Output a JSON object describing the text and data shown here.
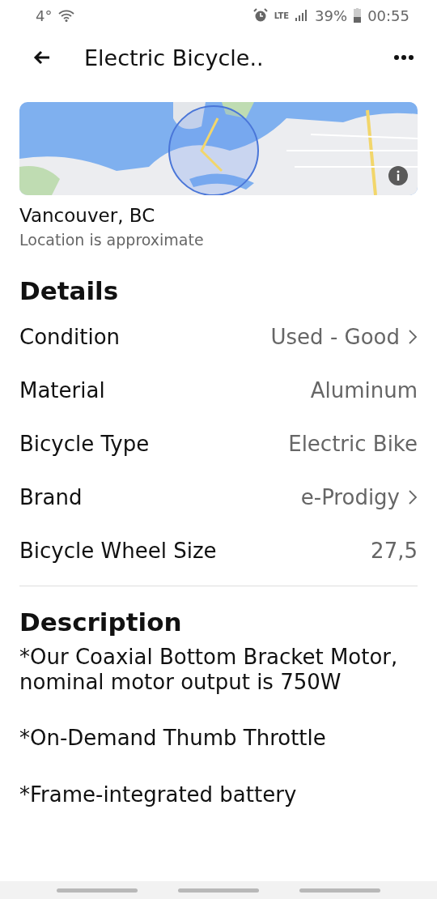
{
  "status_bar": {
    "temperature": "4°",
    "network": "LTE",
    "battery": "39%",
    "time": "00:55"
  },
  "app_bar": {
    "title": "Electric Bicycle.."
  },
  "location": {
    "city": "Vancouver, BC",
    "note": "Location is approximate"
  },
  "details": {
    "title": "Details",
    "rows": [
      {
        "label": "Condition",
        "value": "Used - Good",
        "chevron": true
      },
      {
        "label": "Material",
        "value": "Aluminum",
        "chevron": false
      },
      {
        "label": "Bicycle Type",
        "value": "Electric Bike",
        "chevron": false
      },
      {
        "label": "Brand",
        "value": "e-Prodigy",
        "chevron": true
      },
      {
        "label": "Bicycle Wheel Size",
        "value": "27,5",
        "chevron": false
      }
    ]
  },
  "description": {
    "title": "Description",
    "paragraphs": [
      "*Our Coaxial Bottom Bracket Motor, nominal motor output is 750W",
      "*On-Demand Thumb Throttle",
      "*Frame-integrated battery"
    ]
  }
}
